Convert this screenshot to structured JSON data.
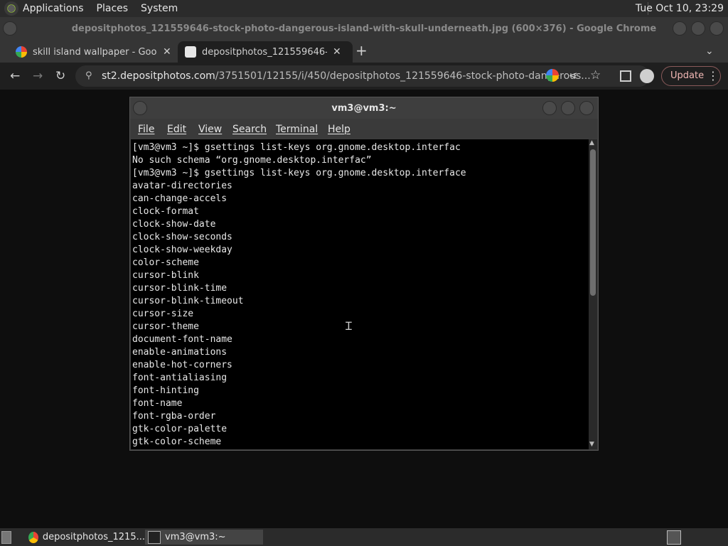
{
  "panel": {
    "menus": [
      "Applications",
      "Places",
      "System"
    ],
    "clock": "Tue Oct 10, 23:29"
  },
  "chrome": {
    "window_title": "depositphotos_121559646-stock-photo-dangerous-island-with-skull-underneath.jpg (600×376) - Google Chrome",
    "tabs": [
      {
        "label": "skill island wallpaper - Google"
      },
      {
        "label": "depositphotos_121559646-stoc"
      }
    ],
    "url_host": "st2.depositphotos.com",
    "url_path": "/3751501/12155/i/450/depositphotos_121559646-stock-photo-dangerous...",
    "update_label": "Update"
  },
  "terminal": {
    "title": "vm3@vm3:~",
    "menu": [
      "File",
      "Edit",
      "View",
      "Search",
      "Terminal",
      "Help"
    ],
    "lines": [
      "[vm3@vm3 ~]$ gsettings list-keys org.gnome.desktop.interfac",
      "No such schema “org.gnome.desktop.interfac”",
      "[vm3@vm3 ~]$ gsettings list-keys org.gnome.desktop.interface",
      "avatar-directories",
      "can-change-accels",
      "clock-format",
      "clock-show-date",
      "clock-show-seconds",
      "clock-show-weekday",
      "color-scheme",
      "cursor-blink",
      "cursor-blink-time",
      "cursor-blink-timeout",
      "cursor-size",
      "cursor-theme",
      "document-font-name",
      "enable-animations",
      "enable-hot-corners",
      "font-antialiasing",
      "font-hinting",
      "font-name",
      "font-rgba-order",
      "gtk-color-palette",
      "gtk-color-scheme"
    ]
  },
  "taskbar": {
    "items": [
      {
        "label": "depositphotos_1215..."
      },
      {
        "label": "vm3@vm3:~"
      }
    ]
  }
}
